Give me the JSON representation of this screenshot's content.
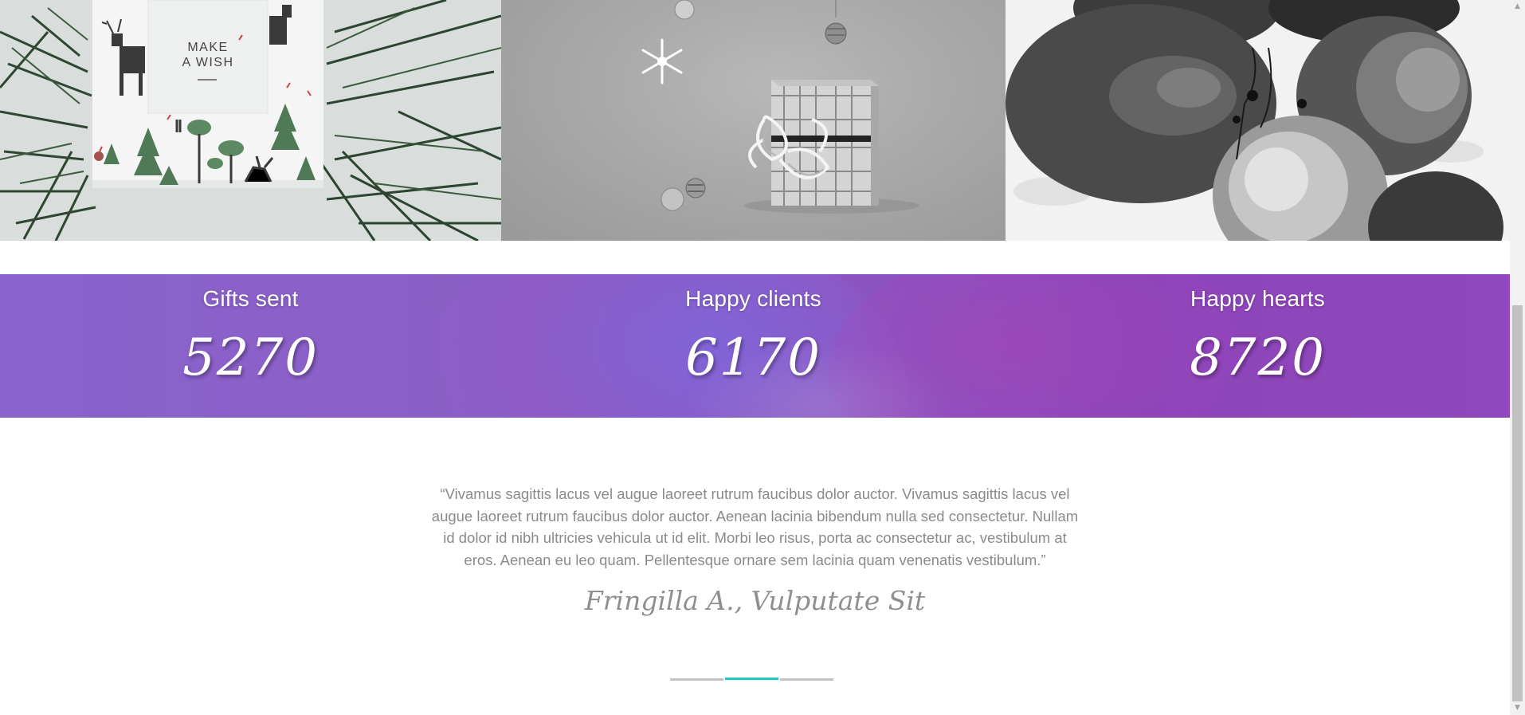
{
  "gallery": {
    "tile1": {
      "gift_tag": [
        "MAKE",
        "A WISH"
      ]
    }
  },
  "stats": [
    {
      "label": "Gifts sent",
      "value": "5270"
    },
    {
      "label": "Happy clients",
      "value": "6170"
    },
    {
      "label": "Happy hearts",
      "value": "8720"
    }
  ],
  "testimonial": {
    "quote": "“Vivamus sagittis lacus vel augue laoreet rutrum faucibus dolor auctor. Vivamus sagittis lacus vel augue laoreet rutrum faucibus dolor auctor. Aenean lacinia bibendum nulla sed consectetur. Nullam id dolor id nibh ultricies vehicula ut id elit. Morbi leo risus, porta ac consectetur ac, vestibulum at eros. Aenean eu leo quam. Pellentesque ornare sem lacinia quam venenatis vestibulum.”",
    "author": "Fringilla A., Vulputate Sit",
    "slides": 3,
    "active_slide": 2
  },
  "scrollbar": {
    "up_arrow": "▲",
    "down_arrow": "▼"
  },
  "colors": {
    "accent": "#1fc8c0",
    "band": "#8a5ac4",
    "quote_text": "#8a8a8a"
  }
}
